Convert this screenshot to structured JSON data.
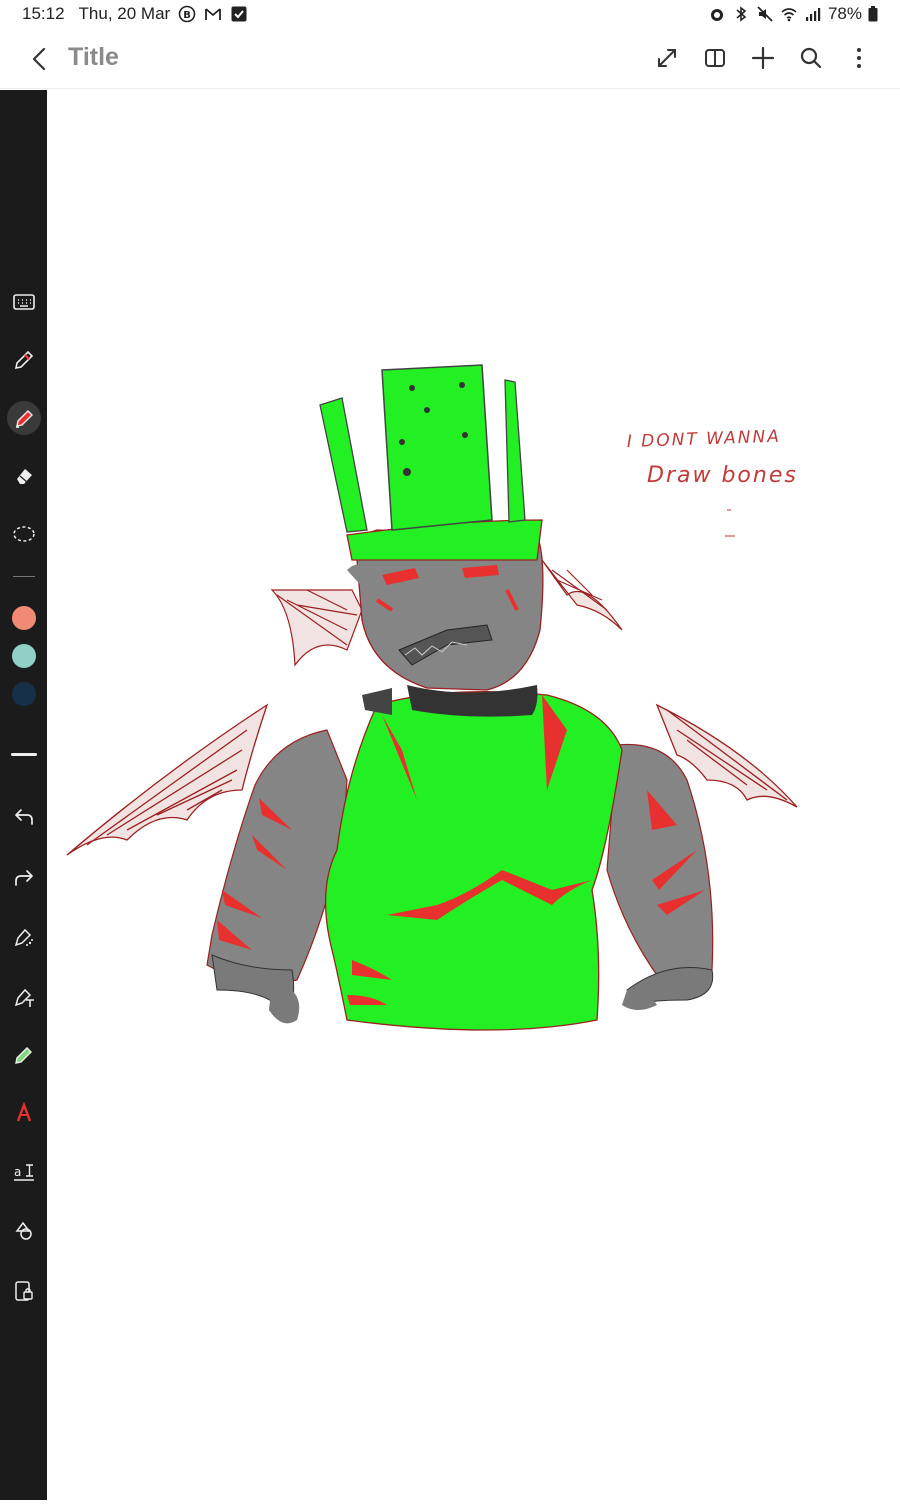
{
  "status_bar": {
    "time": "15:12",
    "date": "Thu, 20 Mar",
    "notification_icons": [
      "b-circle-icon",
      "gmail-icon",
      "check-square-icon"
    ],
    "system_icons": [
      "alarm-icon",
      "bluetooth-icon",
      "mute-icon",
      "wifi-icon",
      "signal-icon",
      "battery-icon"
    ],
    "battery": "78%"
  },
  "app_bar": {
    "title": "Title",
    "actions": [
      "expand-icon",
      "book-view-icon",
      "add-icon",
      "search-icon",
      "more-icon"
    ]
  },
  "toolbar": {
    "tools": [
      "keyboard",
      "pen",
      "highlighter",
      "eraser",
      "lasso-select",
      "undo",
      "redo",
      "shape-pen",
      "text-pen",
      "pencil",
      "ink-to-text",
      "text-size",
      "shapes",
      "lock-page"
    ],
    "active_tool": "highlighter",
    "colors": [
      "#f08a75",
      "#8fd1c5",
      "#163049"
    ]
  },
  "canvas": {
    "handwritten_note": {
      "line1": "I DONT WANNA",
      "line2": "Draw bones"
    },
    "colors": {
      "green": "#22f022",
      "gray": "#858585",
      "red_accent": "#e8312e",
      "sketch_line": "#9b2020"
    }
  }
}
